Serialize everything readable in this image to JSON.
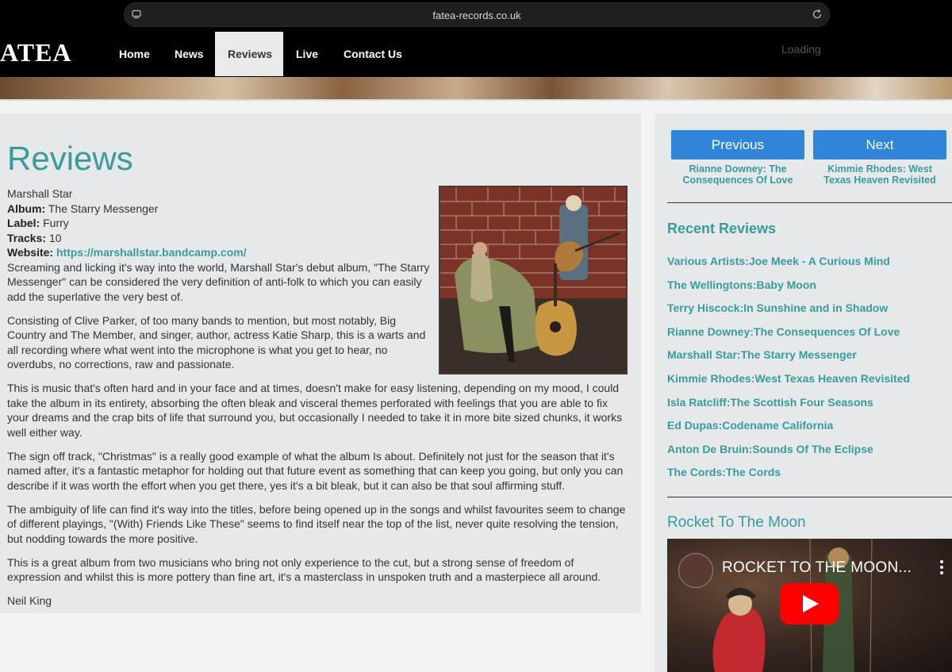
{
  "browser": {
    "url": "fatea-records.co.uk"
  },
  "site": {
    "logo": "ATEA",
    "nav": [
      "Home",
      "News",
      "Reviews",
      "Live",
      "Contact Us"
    ],
    "active_nav": "Reviews",
    "loading": "Loading"
  },
  "main": {
    "title": "Reviews",
    "artist": "Marshall Star",
    "album_label": "Album:",
    "album": "The Starry Messenger",
    "label_label": "Label:",
    "label": "Furry",
    "tracks_label": "Tracks:",
    "tracks": "10",
    "website_label": "Website:",
    "website": "https://marshallstar.bandcamp.com/",
    "paragraphs": [
      "Screaming and licking it's way into the world, Marshall Star's debut album, \"The Starry Messenger\" can be considered the very definition of anti-folk to which you can easily add the superlative the very best of.",
      "Consisting of Clive Parker, of too many bands to mention, but most notably, Big Country and The Member, and singer, author, actress Katie Sharp, this is a warts and all recording where what went into the microphone is what you get to hear, no overdubs, no corrections, raw and passionate.",
      "This is music that's often hard and in your face and at times, doesn't make for easy listening, depending on my mood, I could take the album in its entirety, absorbing the often bleak and visceral themes perforated with feelings that you are able to fix your dreams and the crap bits of life that surround you, but occasionally I needed to take it in more bite sized chunks, it works well either way.",
      "The sign off track, \"Christmas\" is a really good example of what the album Is about. Definitely not just for the season that it's named after, it's a fantastic metaphor for holding out that future event as something that can keep you going, but only you can describe if it was worth the effort when you get there, yes it's a bit bleak, but it can also be that soul affirming stuff.",
      "The ambiguity of life can find it's way into the titles, before being opened up in the songs and whilst favourites seem to change of different playings, \"(With) Friends Like These\" seems to find itself near the top of the list, never quite resolving the tension, but nodding towards the more positive.",
      "This is a great album from two musicians who bring not only experience to the cut, but a strong sense of freedom of expression and whilst this is more pottery than fine art, it's a masterclass in unspoken truth and a masterpiece all around."
    ],
    "author": "Neil King"
  },
  "sidebar": {
    "previous_label": "Previous",
    "previous_title": "Rianne Downey: The Consequences Of Love",
    "next_label": "Next",
    "next_title": "Kimmie Rhodes: West Texas Heaven Revisited",
    "recent_heading": "Recent Reviews",
    "recent": [
      "Various Artists:Joe Meek - A Curious Mind",
      "The Wellingtons:Baby Moon",
      "Terry Hiscock:In Sunshine and in Shadow",
      "Rianne Downey:The Consequences Of Love",
      "Marshall Star:The Starry Messenger",
      "Kimmie Rhodes:West Texas Heaven Revisited",
      "Isla Ratcliff:The Scottish Four Seasons",
      "Ed Dupas:Codename California",
      "Anton De Bruin:Sounds Of The Eclipse",
      "The Cords:The Cords"
    ],
    "video_heading": "Rocket To The Moon",
    "video_title": "ROCKET TO THE MOON..."
  },
  "colors": {
    "accent": "#3a9a9c",
    "button": "#2f86d8",
    "nav_bg": "#000000",
    "panel_bg": "#e5e9ea"
  }
}
